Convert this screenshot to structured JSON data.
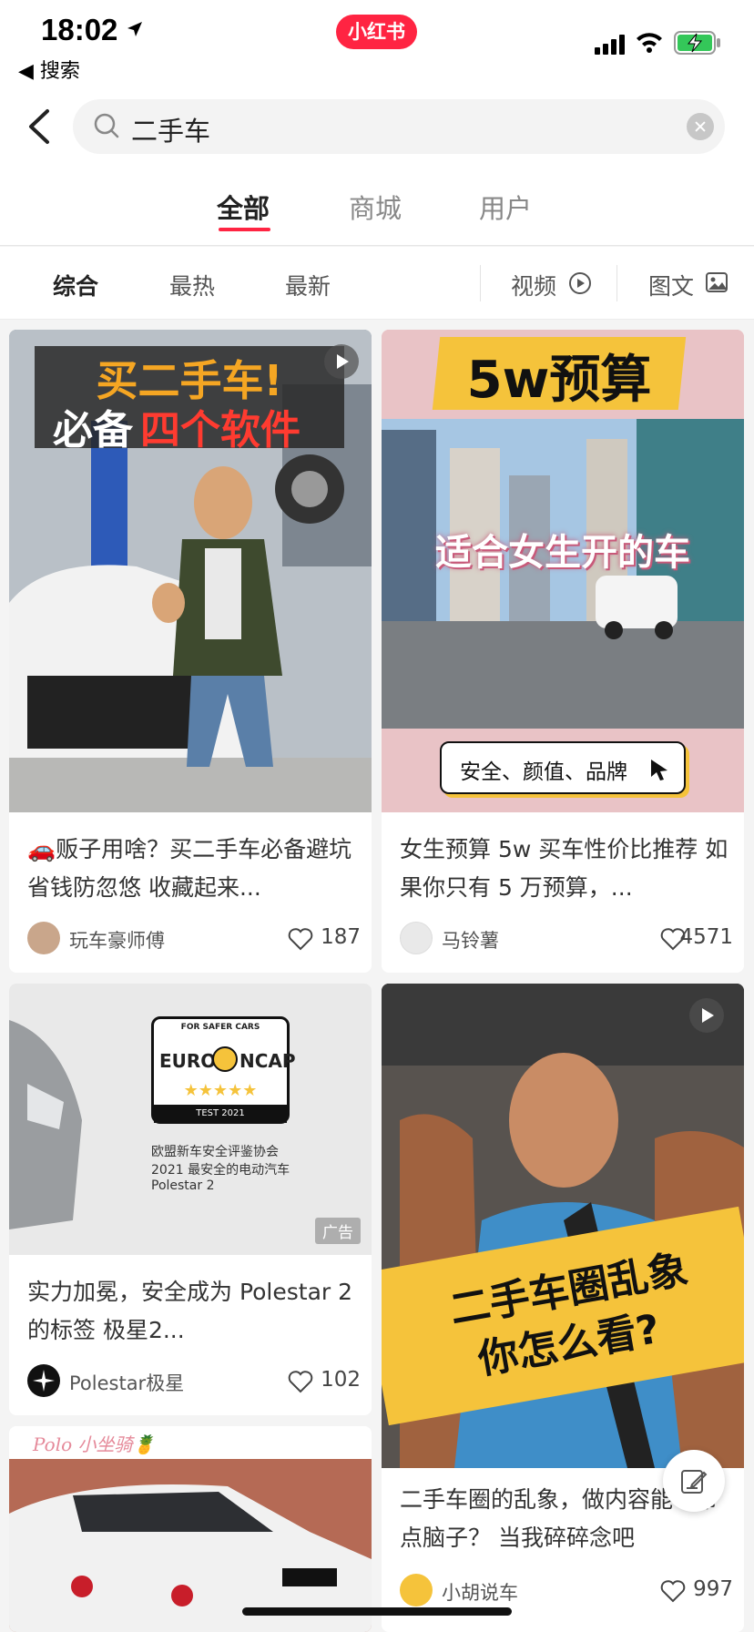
{
  "status": {
    "time": "18:02",
    "back_app": "◀ 搜索",
    "app_badge": "小红书"
  },
  "search": {
    "query": "二手车"
  },
  "top_tabs": [
    "全部",
    "商城",
    "用户"
  ],
  "filters": {
    "sort": [
      "综合",
      "最热",
      "最新"
    ],
    "video": "视频",
    "image_text": "图文"
  },
  "cards": [
    {
      "overlay_line1": "买二手车!",
      "overlay_line2a": "必备",
      "overlay_line2b": "四个软件",
      "title": "🚗贩子用啥？买二手车必备避坑省钱防忽悠 收藏起来...",
      "author": "玩车豪师傅",
      "likes": "187"
    },
    {
      "overlay_top": "5w预算",
      "overlay_mid": "适合女生开的车",
      "overlay_tag": "安全、颜值、品牌",
      "title": "女生预算 5w 买车性价比推荐 如果你只有 5 万预算，...",
      "author": "马铃薯",
      "likes": "4571"
    },
    {
      "badge_top": "FOR SAFER CARS",
      "badge_brand_left": "EURO",
      "badge_brand_right": "NCAP",
      "badge_stars": "★★★★★",
      "badge_year": "TEST 2021",
      "caption1": "欧盟新车安全评鉴协会",
      "caption2": "2021 最安全的电动汽车",
      "caption3": "Polestar 2",
      "ad": "广告",
      "title": "实力加冕，安全成为 Polestar 2的标签 极星2...",
      "author": "Polestar极星",
      "likes": "102"
    },
    {
      "overlay_line1": "二手车圈乱象",
      "overlay_line2": "你怎么看?",
      "title": "二手车圈的乱象，做内容能不带点脑子？ 当我碎碎念吧",
      "author": "小胡说车",
      "likes": "997"
    },
    {
      "handwriting": "Polo 小坐骑🍍"
    }
  ],
  "colors": {
    "brand": "#ff2442",
    "accent_yellow": "#f5c33b"
  }
}
